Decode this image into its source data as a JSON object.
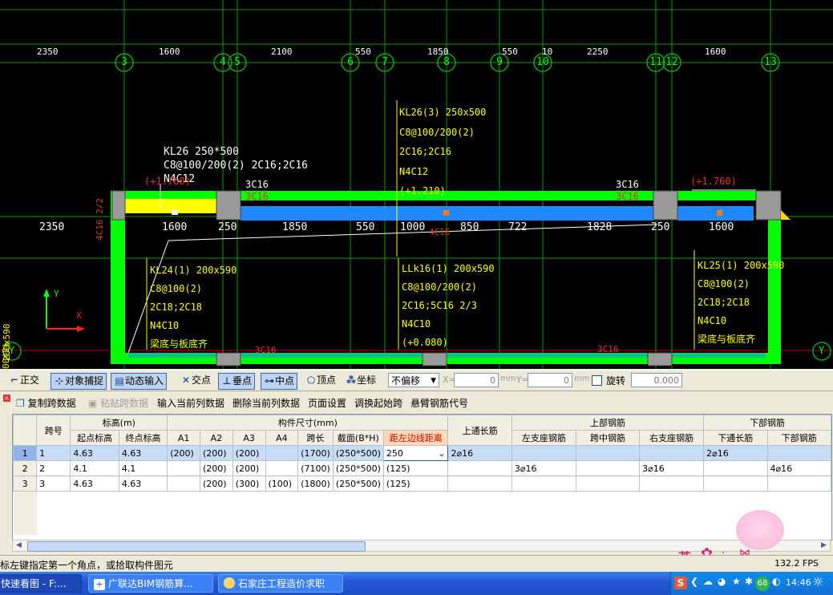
{
  "canvas": {
    "axis_dims_top": [
      "2350",
      "1600",
      "2100",
      "550",
      "1850",
      "550",
      "10",
      "2250",
      "1600"
    ],
    "axis_labels": [
      "3",
      "4",
      "5",
      "6",
      "7",
      "8",
      "9",
      "10",
      "11",
      "12",
      "13"
    ],
    "mid_dims": [
      "2350",
      "1600",
      "250",
      "1850",
      "550",
      "1000",
      "850",
      "722",
      "1828",
      "250",
      "1600"
    ],
    "mid_dim_extra": "4C16",
    "left_vert_text": "4C16 2/2",
    "left_side_text1": "200x590",
    "left_side_text2": "00(2)",
    "ann_kl26_1": "KL26 250*500",
    "ann_kl26_2": "C8@100/200(2) 2C16;2C16",
    "ann_kl26_3": "N4C12",
    "ann_kl26_4": "(+1.760)",
    "ann_3c16_a": "3C16",
    "ann_3c16_b": "3C16",
    "ann_kl26b_1": "KL26(3) 250x500",
    "ann_kl26b_2": "C8@100/200(2)",
    "ann_kl26b_3": "2C16;2C16",
    "ann_kl26b_4": "N4C12",
    "ann_kl26b_5": "(+1.210)",
    "ann_right_3c16_a": "3C16",
    "ann_right_3c16_b": "3C16",
    "ann_right_elev": "(+1.760)",
    "ann_kl24_1": "KL24(1) 200x590",
    "ann_kl24_2": "C8@100(2)",
    "ann_kl24_3": "2C18;2C18",
    "ann_kl24_4": "N4C10",
    "ann_kl24_5": "梁底与板底齐",
    "ann_llk_1": "LLk16(1) 200x590",
    "ann_llk_2": "C8@100/200(2)",
    "ann_llk_3": "2C16;5C16 2/3",
    "ann_llk_4": "N4C10",
    "ann_llk_5": "(+0.080)",
    "ann_kl25_1": "KL25(1) 200x590",
    "ann_kl25_2": "C8@100(2)",
    "ann_kl25_3": "2C18;2C18",
    "ann_kl25_4": "N4C10",
    "ann_kl25_5": "梁底与板底齐",
    "bottom_3c16_a": "3C16",
    "bottom_3c16_b": "3C16",
    "ucs_y": "Y",
    "ucs_x": "X",
    "edge_y_left": "Y",
    "edge_y_right": "Y"
  },
  "snap_toolbar": {
    "ortho": "正交",
    "object_snap": "对象捕捉",
    "dynamic_input": "动态输入",
    "intersection": "交点",
    "perpendicular": "垂点",
    "midpoint": "中点",
    "vertex": "顶点",
    "coordinate": "坐标",
    "offset_select": "不偏移",
    "x_label": "X=",
    "x_value": "0",
    "y_label": "Y=",
    "y_value": "0",
    "unit_mm": "mm",
    "rotate_label": "旋转",
    "rotate_value": "0.000"
  },
  "grid_toolbar": {
    "copy_span": "复制跨数据",
    "paste_span": "粘贴跨数据",
    "input_current_col": "输入当前列数据",
    "delete_current_col": "删除当前列数据",
    "page_setup": "页面设置",
    "swap_start_span": "调换起始跨",
    "cantilever_code": "悬臂钢筋代号"
  },
  "table": {
    "headers": {
      "span_no": "跨号",
      "elevation": "标高(m)",
      "start_elev": "起点标高",
      "end_elev": "终点标高",
      "dims": "构件尺寸(mm)",
      "a1": "A1",
      "a2": "A2",
      "a3": "A3",
      "a4": "A4",
      "span_len": "跨长",
      "section": "截面(B*H)",
      "left_edge": "距左边线距离",
      "top_through": "上通长筋",
      "top_rebar": "上部钢筋",
      "left_support": "左支座钢筋",
      "mid_span": "跨中钢筋",
      "right_support": "右支座钢筋",
      "bottom_rebar": "下部钢筋",
      "bottom_through": "下通长筋",
      "bottom_bar": "下部钢筋"
    },
    "rows": [
      {
        "n": "1",
        "span": "1",
        "start": "4.63",
        "end": "4.63",
        "a1": "(200)",
        "a2": "(200)",
        "a3": "(200)",
        "a4": "",
        "len": "(1700)",
        "sec": "(250*500)",
        "left": "250",
        "top": "2⌀16",
        "ls": "",
        "mid": "",
        "rs": "",
        "bt": "2⌀16",
        "bb": ""
      },
      {
        "n": "2",
        "span": "2",
        "start": "4.1",
        "end": "4.1",
        "a1": "",
        "a2": "(200)",
        "a3": "(200)",
        "a4": "",
        "len": "(7100)",
        "sec": "(250*500)",
        "left": "(125)",
        "top": "",
        "ls": "3⌀16",
        "mid": "",
        "rs": "3⌀16",
        "bt": "",
        "bb": "4⌀16"
      },
      {
        "n": "3",
        "span": "3",
        "start": "4.63",
        "end": "4.63",
        "a1": "",
        "a2": "(200)",
        "a3": "(300)",
        "a4": "(100)",
        "len": "(1800)",
        "sec": "(250*500)",
        "left": "(125)",
        "top": "",
        "ls": "",
        "mid": "",
        "rs": "",
        "bt": "",
        "bb": ""
      }
    ]
  },
  "status": {
    "hint": "鼠标左键指定第一个角点，或拾取构件图元",
    "fps": "132.2 FPS",
    "ime": "英"
  },
  "taskbar": {
    "task1": "快速看图 - F:...",
    "task2": "广联达BIM钢筋算...",
    "task3": "石家庄工程造价求职",
    "time": "14:46",
    "tray_badge": "68"
  }
}
